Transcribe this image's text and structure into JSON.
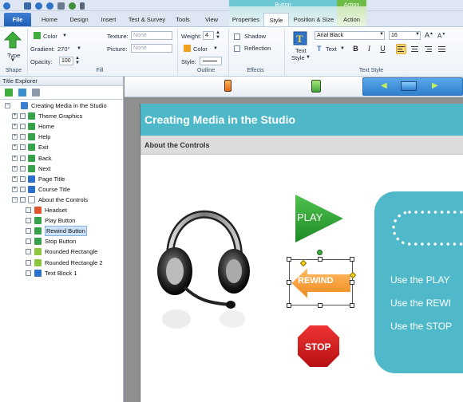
{
  "ribbon": {
    "context_tabs": {
      "button": "Button",
      "action": "Action"
    },
    "tabs": [
      "File",
      "Home",
      "Design",
      "Insert",
      "Test & Survey",
      "Tools",
      "View",
      "Properties",
      "Style",
      "Position & Size",
      "Action"
    ],
    "active_tab": "Style",
    "shape": {
      "type_label": "Type",
      "group_label": "Shape"
    },
    "fill": {
      "color_label": "Color",
      "gradient_label": "Gradient:",
      "gradient_value": "270°",
      "opacity_label": "Opacity:",
      "opacity_value": "100",
      "texture_label": "Texture:",
      "texture_value": "None",
      "picture_label": "Picture:",
      "picture_value": "None",
      "group_label": "Fill"
    },
    "outline": {
      "weight_label": "Weight:",
      "weight_value": "4",
      "color_label": "Color",
      "style_label": "Style:",
      "group_label": "Outline"
    },
    "effects": {
      "shadow_label": "Shadow",
      "reflection_label": "Reflection",
      "group_label": "Effects"
    },
    "text_style": {
      "text_style_label": "Text",
      "text_style_label2": "Style",
      "font_value": "Arial Black",
      "size_value": "16",
      "text_label": "Text",
      "bold": "B",
      "italic": "I",
      "underline": "U",
      "group_label": "Text Style"
    }
  },
  "title_explorer": {
    "title": "Title Explorer",
    "tree": [
      {
        "label": "Creating Media in the Studio",
        "level": 0,
        "icon": "course",
        "color": "#3a7fd0"
      },
      {
        "label": "Theme Graphics",
        "level": 1,
        "icon": "page",
        "color": "#36a34a"
      },
      {
        "label": "Home",
        "level": 1,
        "icon": "page",
        "color": "#36a34a"
      },
      {
        "label": "Help",
        "level": 1,
        "icon": "page",
        "color": "#36a34a"
      },
      {
        "label": "Exit",
        "level": 1,
        "icon": "page",
        "color": "#36a34a"
      },
      {
        "label": "Back",
        "level": 1,
        "icon": "page",
        "color": "#36a34a"
      },
      {
        "label": "Next",
        "level": 1,
        "icon": "page",
        "color": "#36a34a"
      },
      {
        "label": "Page Title",
        "level": 1,
        "icon": "text",
        "color": "#2a6fc9"
      },
      {
        "label": "Course Title",
        "level": 1,
        "icon": "text",
        "color": "#2a6fc9"
      },
      {
        "label": "About the Controls",
        "level": 1,
        "icon": "page",
        "color": "#ffffff"
      },
      {
        "label": "Headset",
        "level": 2,
        "icon": "image",
        "color": "#e0562c"
      },
      {
        "label": "Play Button",
        "level": 2,
        "icon": "button",
        "color": "#36a34a"
      },
      {
        "label": "Rewind Button",
        "level": 2,
        "icon": "button",
        "color": "#36a34a",
        "selected": true
      },
      {
        "label": "Stop Button",
        "level": 2,
        "icon": "button",
        "color": "#36a34a"
      },
      {
        "label": "Rounded Rectangle",
        "level": 2,
        "icon": "shape",
        "color": "#8cc63f"
      },
      {
        "label": "Rounded Rectangle 2",
        "level": 2,
        "icon": "shape",
        "color": "#8cc63f"
      },
      {
        "label": "Text Block 1",
        "level": 2,
        "icon": "text",
        "color": "#2a6fc9"
      }
    ]
  },
  "slide": {
    "title": "Creating Media in the Studio",
    "subtitle": "About the Controls",
    "play_label": "PLAY",
    "rewind_label": "REWIND",
    "stop_label": "STOP",
    "instructions": [
      "Use the PLAY",
      "Use the REWI",
      "Use the STOP"
    ]
  }
}
